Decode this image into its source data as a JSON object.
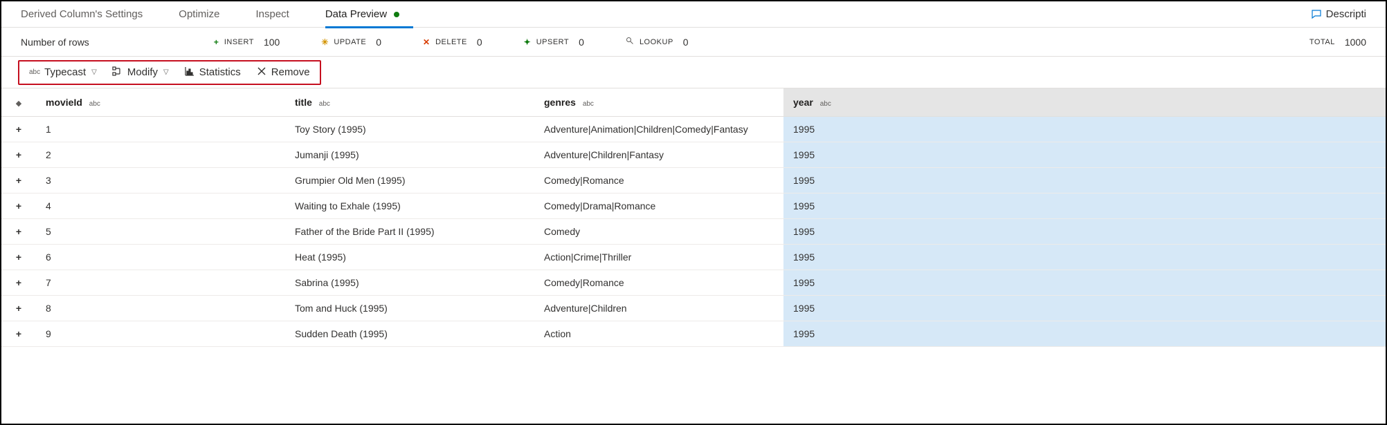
{
  "tabs": {
    "derived": "Derived Column's Settings",
    "optimize": "Optimize",
    "inspect": "Inspect",
    "preview": "Data Preview"
  },
  "description_link": "Descripti",
  "stats": {
    "label": "Number of rows",
    "insert": {
      "name": "INSERT",
      "value": "100"
    },
    "update": {
      "name": "UPDATE",
      "value": "0"
    },
    "delete": {
      "name": "DELETE",
      "value": "0"
    },
    "upsert": {
      "name": "UPSERT",
      "value": "0"
    },
    "lookup": {
      "name": "LOOKUP",
      "value": "0"
    },
    "total": {
      "name": "TOTAL",
      "value": "1000"
    }
  },
  "toolbar": {
    "typecast": "Typecast",
    "modify": "Modify",
    "statistics": "Statistics",
    "remove": "Remove"
  },
  "columns": {
    "movieId": {
      "name": "movieId",
      "type": "abc"
    },
    "title": {
      "name": "title",
      "type": "abc"
    },
    "genres": {
      "name": "genres",
      "type": "abc"
    },
    "year": {
      "name": "year",
      "type": "abc"
    }
  },
  "rows": [
    {
      "movieId": "1",
      "title": "Toy Story (1995)",
      "genres": "Adventure|Animation|Children|Comedy|Fantasy",
      "year": "1995"
    },
    {
      "movieId": "2",
      "title": "Jumanji (1995)",
      "genres": "Adventure|Children|Fantasy",
      "year": "1995"
    },
    {
      "movieId": "3",
      "title": "Grumpier Old Men (1995)",
      "genres": "Comedy|Romance",
      "year": "1995"
    },
    {
      "movieId": "4",
      "title": "Waiting to Exhale (1995)",
      "genres": "Comedy|Drama|Romance",
      "year": "1995"
    },
    {
      "movieId": "5",
      "title": "Father of the Bride Part II (1995)",
      "genres": "Comedy",
      "year": "1995"
    },
    {
      "movieId": "6",
      "title": "Heat (1995)",
      "genres": "Action|Crime|Thriller",
      "year": "1995"
    },
    {
      "movieId": "7",
      "title": "Sabrina (1995)",
      "genres": "Comedy|Romance",
      "year": "1995"
    },
    {
      "movieId": "8",
      "title": "Tom and Huck (1995)",
      "genres": "Adventure|Children",
      "year": "1995"
    },
    {
      "movieId": "9",
      "title": "Sudden Death (1995)",
      "genres": "Action",
      "year": "1995"
    }
  ]
}
